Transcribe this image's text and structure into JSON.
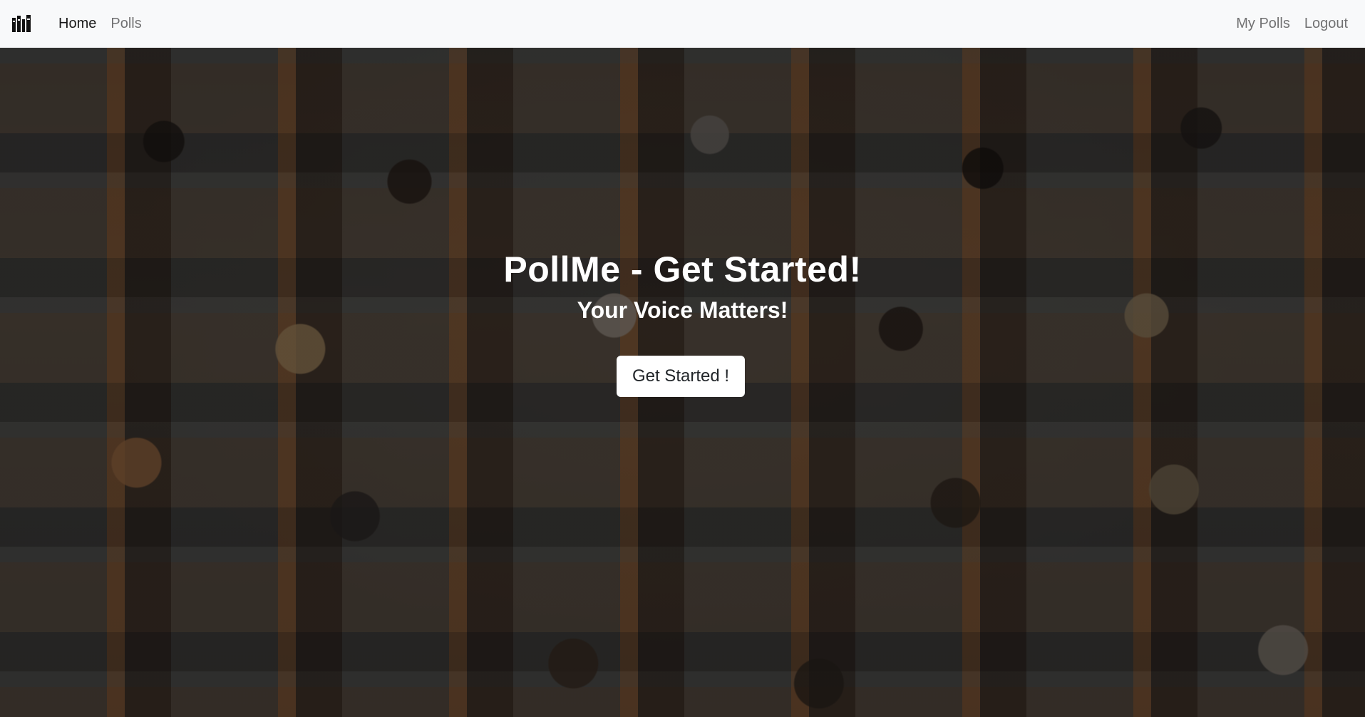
{
  "navbar": {
    "brand_icon": "library-books-icon",
    "left_links": [
      {
        "label": "Home",
        "active": true
      },
      {
        "label": "Polls",
        "active": false
      }
    ],
    "right_links": [
      {
        "label": "My Polls"
      },
      {
        "label": "Logout"
      }
    ]
  },
  "hero": {
    "title": "PollMe - Get Started!",
    "subtitle": "Your Voice Matters!",
    "button_label": "Get Started !"
  },
  "colors": {
    "navbar_bg": "#f8f9fa",
    "hero_text": "#ffffff",
    "button_bg": "#ffffff"
  }
}
